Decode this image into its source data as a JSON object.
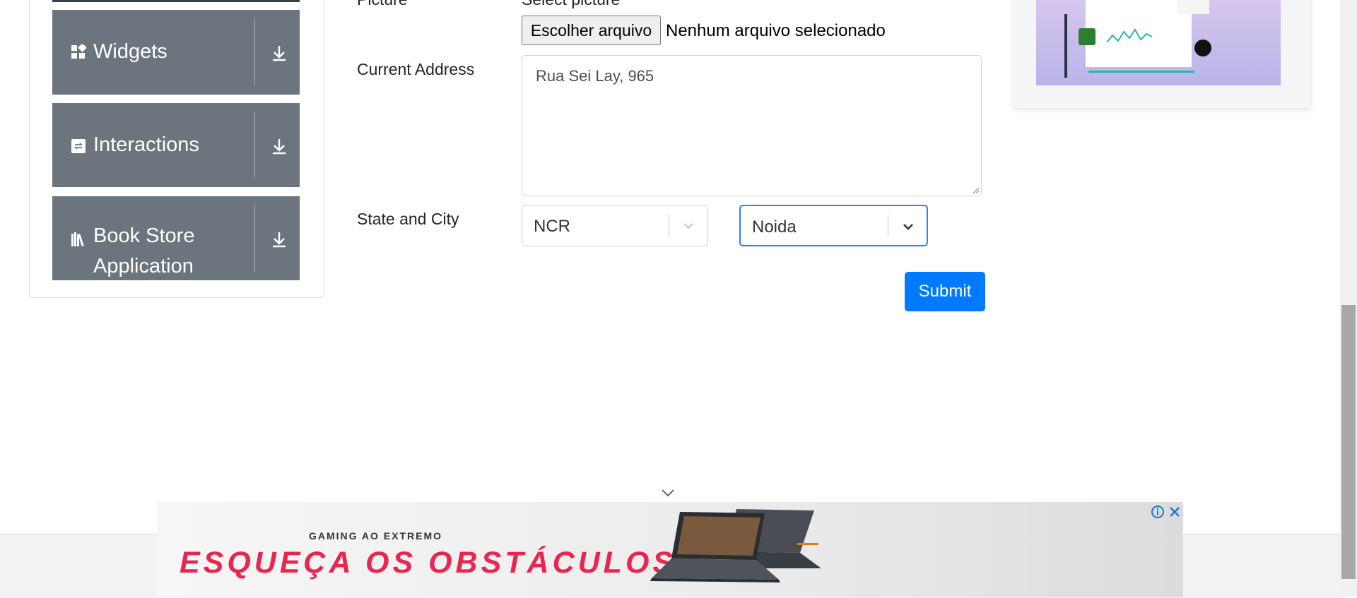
{
  "sidebar": {
    "groups": [
      {
        "label": "Widgets",
        "icon": "widgets-icon"
      },
      {
        "label": "Interactions",
        "icon": "interactions-icon"
      },
      {
        "label": "Book Store",
        "label_line2": "Application",
        "icon": "bookstore-icon"
      }
    ],
    "download_icon": "download-arrow-icon"
  },
  "form": {
    "picture_label": "Picture",
    "picture_hint": "Select picture",
    "file_button": "Escolher arquivo",
    "file_status": "Nenhum arquivo selecionado",
    "address_label": "Current Address",
    "address_value": "Rua Sei Lay, 965",
    "state_city_label": "State and City",
    "state_value": "NCR",
    "city_value": "Noida",
    "submit_label": "Submit"
  },
  "ad": {
    "kicker": "GAMING AO EXTREMO",
    "headline": "ESQUEÇA OS OBSTÁCULOS",
    "info_icon": "info-icon",
    "close_icon": "close-icon"
  },
  "colors": {
    "menu_bg": "#6c757d",
    "primary": "#007bff",
    "focus": "#2684ff",
    "ad_headline": "#e8264f"
  }
}
